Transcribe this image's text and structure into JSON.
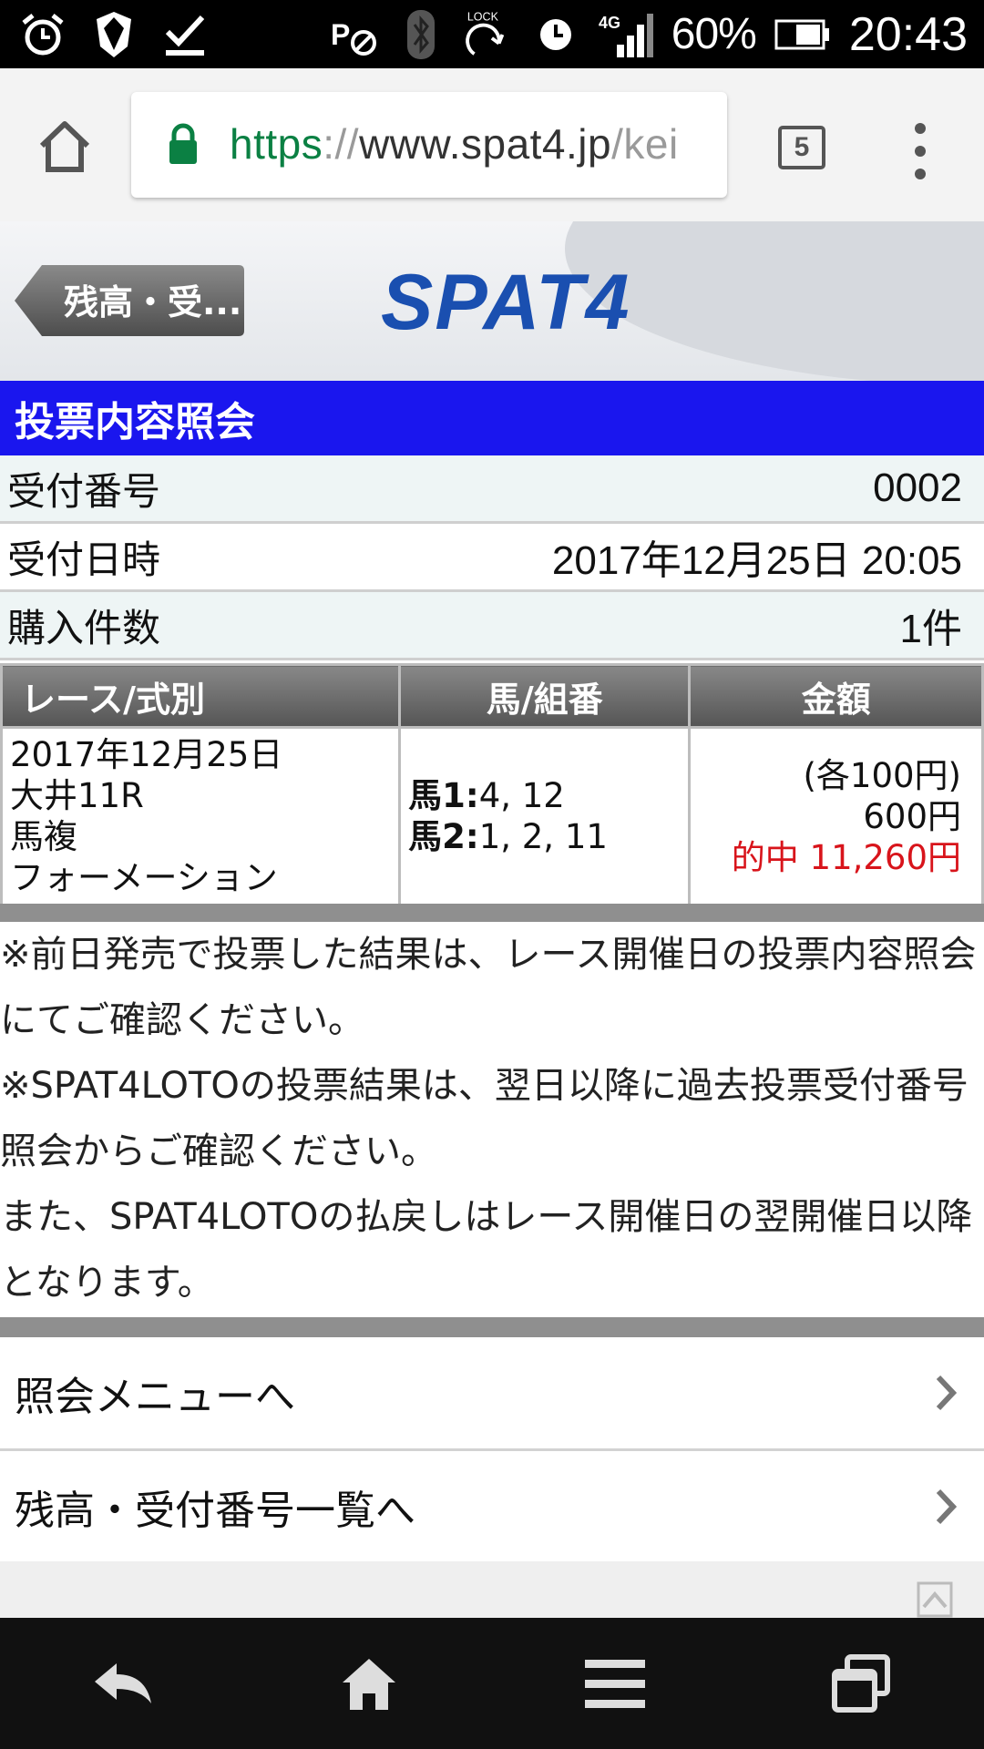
{
  "status_bar": {
    "network": "4G",
    "battery": "60%",
    "time": "20:43",
    "lock_label": "LOCK"
  },
  "browser": {
    "url_scheme": "https",
    "url_sep": "://",
    "url_host": "www.spat4.jp",
    "url_path": "/kei",
    "tab_count": "5"
  },
  "header": {
    "back_label": "残高・受...",
    "logo": "SPAT4"
  },
  "page": {
    "title": "投票内容照会"
  },
  "info": [
    {
      "label": "受付番号",
      "value": "0002"
    },
    {
      "label": "受付日時",
      "value": "2017年12月25日 20:05"
    },
    {
      "label": "購入件数",
      "value": "1件"
    }
  ],
  "table": {
    "headers": [
      "レース/式別",
      "馬/組番",
      "金額"
    ],
    "race": {
      "date": "2017年12月25日",
      "race": "大井11R",
      "bet_type": "馬複",
      "method": "フォーメーション"
    },
    "combo": {
      "l1_label": "馬1:",
      "l1_value": "4, 12",
      "l2_label": "馬2:",
      "l2_value": "1, 2, 11"
    },
    "amount": {
      "unit": "(各100円)",
      "total": "600円",
      "hit": "的中 11,260円"
    }
  },
  "notes": {
    "n1": "※前日発売で投票した結果は、レース開催日の投票内容照会にてご確認ください。",
    "n2": "※SPAT4LOTOの投票結果は、翌日以降に過去投票受付番号照会からご確認ください。",
    "n3": "また、SPAT4LOTOの払戻しはレース開催日の翌開催日以降となります。"
  },
  "links": {
    "menu": "照会メニューへ",
    "balance": "残高・受付番号一覧へ"
  },
  "colors": {
    "title_bar": "#1a16ee",
    "hit": "#d8141b",
    "logo": "#1a4fb0",
    "secure": "#0b8043"
  }
}
